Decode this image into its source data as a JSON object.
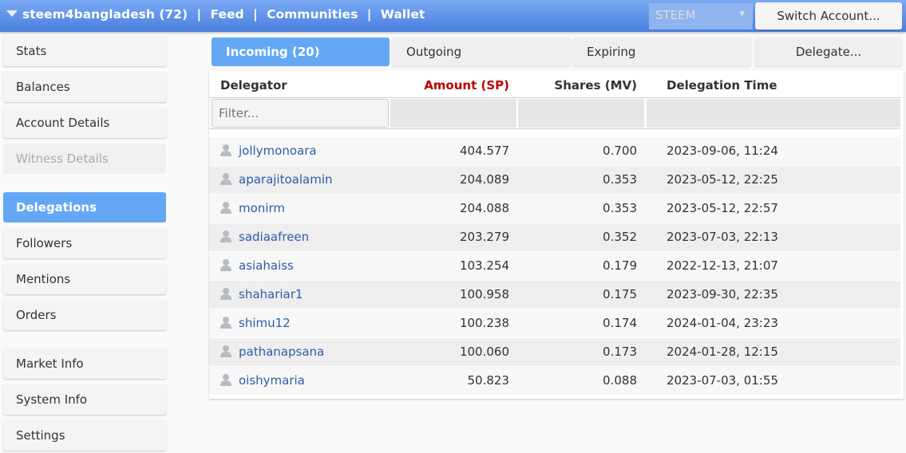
{
  "header": {
    "account": "steem4bangladesh (72)",
    "sep": "|",
    "links": [
      "Feed",
      "Communities",
      "Wallet"
    ],
    "currency": "STEEM",
    "switch_label": "Switch Account..."
  },
  "sidebar": [
    "Stats",
    "Balances",
    "Account Details",
    "Witness Details",
    "Delegations",
    "Followers",
    "Mentions",
    "Orders",
    "Market Info",
    "System Info",
    "Settings"
  ],
  "tabs": [
    "Incoming (20)",
    "Outgoing",
    "Expiring",
    "Delegate..."
  ],
  "table": {
    "headers": [
      "Delegator",
      "Amount (SP)",
      "Shares (MV)",
      "Delegation Time"
    ],
    "filter_placeholder": "Filter...",
    "rows": [
      [
        "jollymonoara",
        "404.577",
        "0.700",
        "2023-09-06, 11:24"
      ],
      [
        "aparajitoalamin",
        "204.089",
        "0.353",
        "2023-05-12, 22:25"
      ],
      [
        "monirm",
        "204.088",
        "0.353",
        "2023-05-12, 22:57"
      ],
      [
        "sadiaafreen",
        "203.279",
        "0.352",
        "2023-07-03, 22:13"
      ],
      [
        "asiahaiss",
        "103.254",
        "0.179",
        "2022-12-13, 21:07"
      ],
      [
        "shahariar1",
        "100.958",
        "0.175",
        "2023-09-30, 22:35"
      ],
      [
        "shimu12",
        "100.238",
        "0.174",
        "2024-01-04, 23:23"
      ],
      [
        "pathanapsana",
        "100.060",
        "0.173",
        "2024-01-28, 12:15"
      ],
      [
        "oishymaria",
        "50.823",
        "0.088",
        "2023-07-03, 01:55"
      ]
    ]
  },
  "colors": {
    "header": "#4a7fdc",
    "active": "#64a8f5",
    "amount_header": "#bb0000",
    "link": "#2a5dab"
  }
}
